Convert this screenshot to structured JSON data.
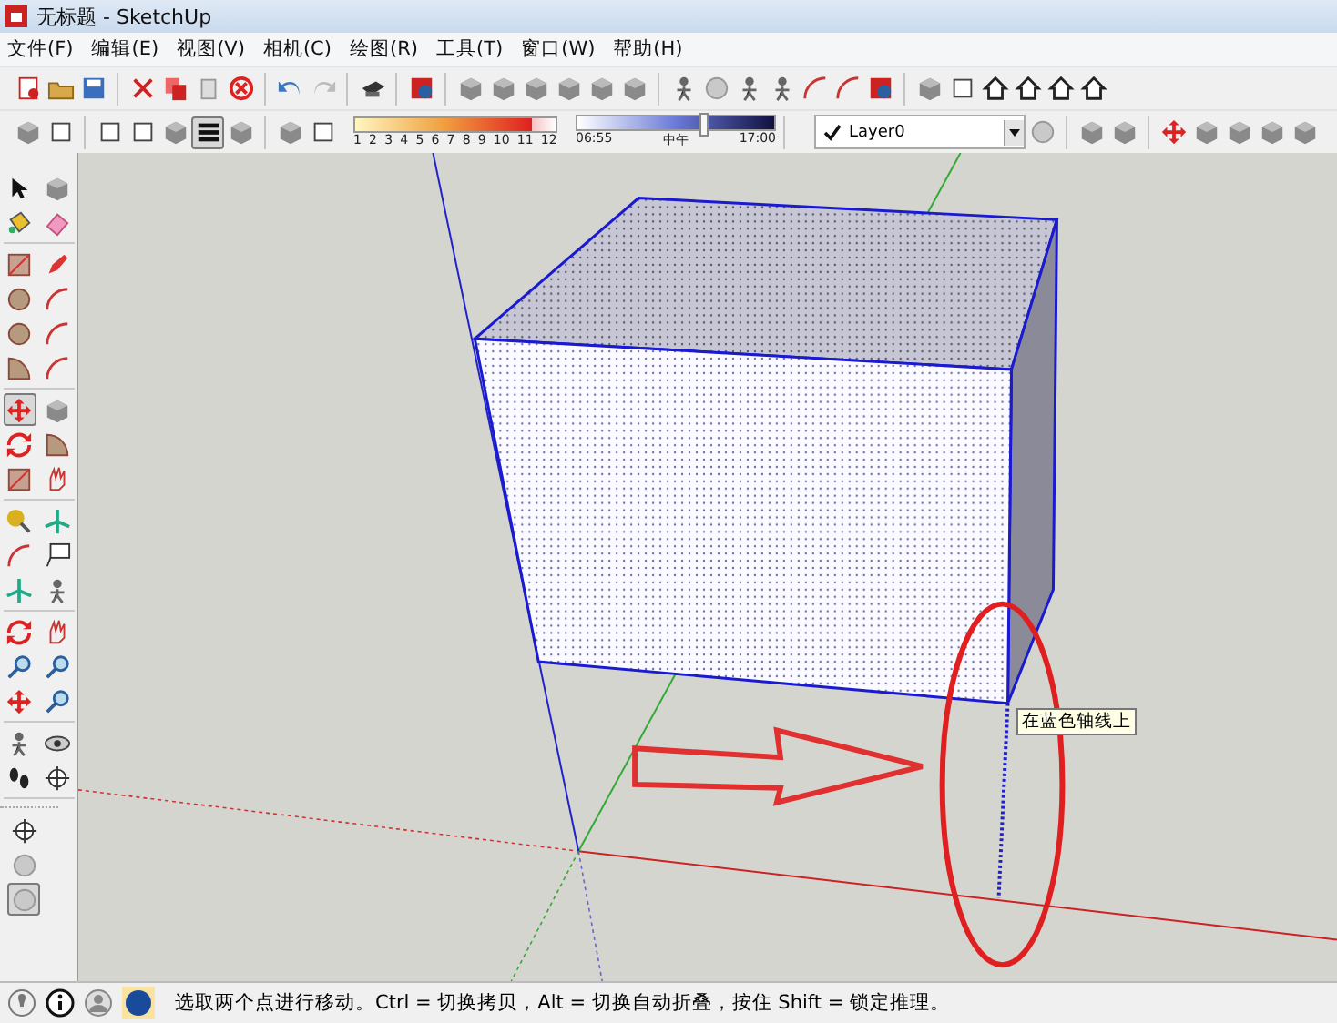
{
  "window": {
    "title": "无标题 - SketchUp"
  },
  "menu": [
    "文件(F)",
    "编辑(E)",
    "视图(V)",
    "相机(C)",
    "绘图(R)",
    "工具(T)",
    "窗口(W)",
    "帮助(H)"
  ],
  "face_styles": [
    {
      "selected": false
    },
    {
      "selected": false
    },
    {
      "selected": false
    },
    {
      "selected": false
    },
    {
      "selected": false
    },
    {
      "selected": true
    },
    {
      "selected": false
    }
  ],
  "shadow_months": [
    "1",
    "2",
    "3",
    "4",
    "5",
    "6",
    "7",
    "8",
    "9",
    "10",
    "11",
    "12"
  ],
  "time_slider": {
    "start": "06:55",
    "middle": "中午",
    "end": "17:00",
    "level": 0.64
  },
  "layer": {
    "name": "Layer0",
    "current": true
  },
  "left_tools": [
    {
      "selected": false
    },
    {
      "selected": false
    },
    {
      "selected": false
    },
    {
      "selected": false
    },
    {
      "selected": false
    },
    {
      "selected": false
    },
    {
      "selected": false
    },
    {
      "selected": false
    },
    {
      "selected": false
    },
    {
      "selected": false
    },
    {
      "selected": false
    },
    {
      "selected": false
    },
    {
      "selected": true
    },
    {
      "selected": false
    },
    {
      "selected": false
    },
    {
      "selected": false
    },
    {
      "selected": false
    },
    {
      "selected": false
    },
    {
      "selected": false
    },
    {
      "selected": false
    },
    {
      "selected": false
    },
    {
      "selected": false
    },
    {
      "selected": false
    },
    {
      "selected": false
    },
    {
      "selected": false
    },
    {
      "selected": false
    },
    {
      "selected": false
    },
    {
      "selected": false
    },
    {
      "selected": false
    },
    {
      "selected": false
    },
    {
      "selected": false
    },
    {
      "selected": false
    },
    {
      "selected": false
    },
    {
      "selected": false
    }
  ],
  "camera_tools": [
    {
      "selected": false
    },
    {
      "selected": false
    },
    {
      "selected": true
    }
  ],
  "tooltip": "在蓝色轴线上",
  "status_bar": {
    "message": "选取两个点进行移动。Ctrl = 切换拷贝，Alt = 切换自动折叠，按住 Shift = 锁定推理。"
  }
}
